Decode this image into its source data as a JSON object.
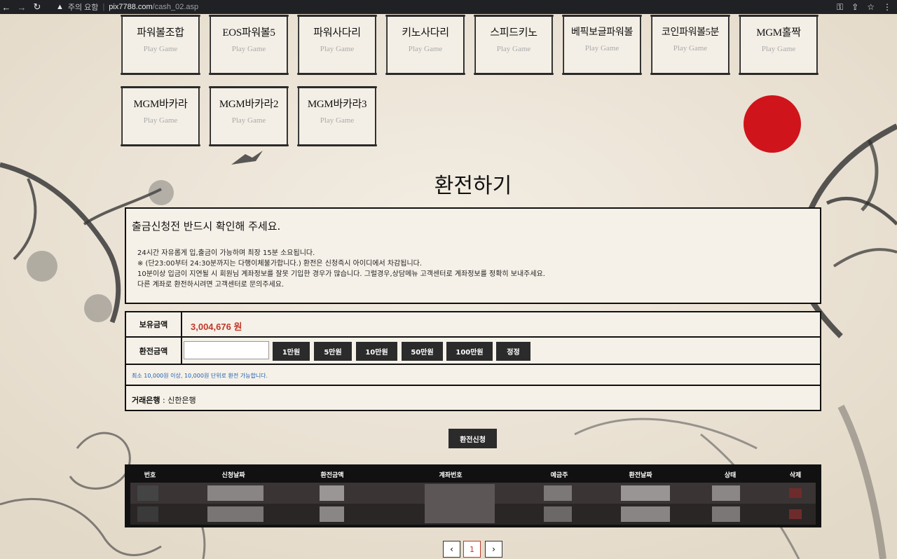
{
  "browser": {
    "warning": "주의 요함",
    "url_host": "pix7788.com",
    "url_path": "/cash_02.asp"
  },
  "games": [
    {
      "name": "파워볼조합",
      "sub": "Play Game"
    },
    {
      "name": "EOS파워볼5",
      "sub": "Play Game"
    },
    {
      "name": "파워사다리",
      "sub": "Play Game"
    },
    {
      "name": "키노사다리",
      "sub": "Play Game"
    },
    {
      "name": "스피드키노",
      "sub": "Play Game"
    },
    {
      "name": "베픽보글파워볼",
      "sub": "Play Game"
    },
    {
      "name": "코인파워볼5분",
      "sub": "Play Game"
    },
    {
      "name": "MGM홀짝",
      "sub": "Play Game"
    },
    {
      "name": "MGM바카라",
      "sub": "Play Game"
    },
    {
      "name": "MGM바카라2",
      "sub": "Play Game"
    },
    {
      "name": "MGM바카라3",
      "sub": "Play Game"
    }
  ],
  "page_title": "환전하기",
  "notice": {
    "heading": "출금신청전 반드시 확인해 주세요.",
    "lines": [
      "24시간 자유롭게 입,출금이 가능하며 최장 15분 소요됩니다.",
      "※ (단23:00부터 24:30분까지는 다행이체불가합니다.) 환전은 신청즉시 아이디에서 차감됩니다.",
      "10분이상 입금이 지연될 시 회원님 계좌정보를 잘못 기입한 경우가 많습니다. 그럴경우,상담메뉴 고객센터로 계좌정보를 정확히 보내주세요.",
      "다른 계좌로 환전하시려면 고객센터로 문의주세요."
    ]
  },
  "form": {
    "balance_label": "보유금액",
    "balance_value": "3,004,676 원",
    "amount_label": "환전금액",
    "amount_value": "",
    "quick_buttons": [
      "1만원",
      "5만원",
      "10만원",
      "50만원",
      "100만원",
      "정정"
    ],
    "hint": "최소 10,000원  이상, 10,000원  단위로 환전 가능합니다.",
    "bank_label": "거래은행",
    "bank_value": " : 신한은행"
  },
  "submit_label": "환전신청",
  "history": {
    "columns": [
      "번호",
      "신청날짜",
      "환전금액",
      "계좌번호",
      "예금주",
      "환전날짜",
      "상태",
      "삭제"
    ]
  },
  "pagination": {
    "prev": "‹",
    "current": "1",
    "next": "›"
  }
}
